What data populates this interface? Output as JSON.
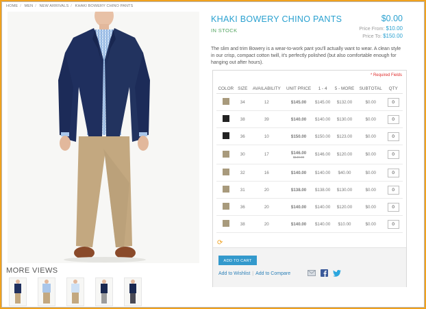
{
  "breadcrumb": [
    "HOME",
    "MEN",
    "NEW ARRIVALS",
    "KHAKI BOWERY CHINO PANTS"
  ],
  "product": {
    "title": "KHAKI BOWERY CHINO PANTS",
    "stock": "IN STOCK",
    "price": "$0.00",
    "price_from_label": "Price From:",
    "price_from": "$10.00",
    "price_to_label": "Price To:",
    "price_to": "$150.00",
    "description": "The slim and trim Bowery is a wear-to-work pant you'll actually want to wear. A clean style in our crisp, compact cotton twill, it's perfectly polished (but also comfortable enough for hanging out after hours)."
  },
  "more_views": {
    "label": "MORE VIEWS",
    "thumbs": [
      "front-jacket",
      "shirt",
      "chinos",
      "jacket-side",
      "dark-jacket"
    ]
  },
  "grouped": {
    "required_label": "* Required Fields",
    "columns": [
      "COLOR",
      "SIZE",
      "AVAILABILITY",
      "UNIT PRICE",
      "1 - 4",
      "5 - MORE",
      "SUBTOTAL",
      "QTY"
    ],
    "rows": [
      {
        "color": "#a89a7c",
        "size": "34",
        "avail": "12",
        "unit": "$145.00",
        "old": "",
        "p1": "$145.00",
        "p5": "$132.00",
        "sub": "$0.00",
        "qty": "0"
      },
      {
        "color": "#222222",
        "size": "38",
        "avail": "39",
        "unit": "$140.00",
        "old": "",
        "p1": "$140.00",
        "p5": "$130.00",
        "sub": "$0.00",
        "qty": "0"
      },
      {
        "color": "#222222",
        "size": "36",
        "avail": "10",
        "unit": "$150.00",
        "old": "",
        "p1": "$150.00",
        "p5": "$123.00",
        "sub": "$0.00",
        "qty": "0"
      },
      {
        "color": "#a89a7c",
        "size": "30",
        "avail": "17",
        "unit": "$146.00",
        "old": "$149.00",
        "p1": "$146.00",
        "p5": "$120.00",
        "sub": "$0.00",
        "qty": "0"
      },
      {
        "color": "#a89a7c",
        "size": "32",
        "avail": "16",
        "unit": "$140.00",
        "old": "",
        "p1": "$140.00",
        "p5": "$40.00",
        "sub": "$0.00",
        "qty": "0"
      },
      {
        "color": "#a89a7c",
        "size": "31",
        "avail": "20",
        "unit": "$138.00",
        "old": "",
        "p1": "$138.00",
        "p5": "$130.00",
        "sub": "$0.00",
        "qty": "0"
      },
      {
        "color": "#a89a7c",
        "size": "36",
        "avail": "20",
        "unit": "$140.00",
        "old": "",
        "p1": "$140.00",
        "p5": "$120.00",
        "sub": "$0.00",
        "qty": "0"
      },
      {
        "color": "#a89a7c",
        "size": "38",
        "avail": "20",
        "unit": "$140.00",
        "old": "",
        "p1": "$140.00",
        "p5": "$10.00",
        "sub": "$0.00",
        "qty": "0"
      }
    ],
    "add_to_cart": "ADD TO CART",
    "add_to_wishlist": "Add to Wishlist",
    "add_to_compare": "Add to Compare",
    "icons": [
      "email-icon",
      "facebook-icon",
      "twitter-icon"
    ]
  },
  "colors": {
    "accent": "#2aa1d0",
    "in_stock": "#52a45f",
    "button": "#3399cc",
    "frame": "#f0a11d",
    "required": "#df2c2c"
  }
}
